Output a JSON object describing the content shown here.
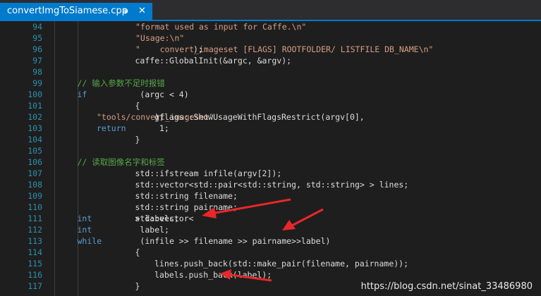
{
  "tab": {
    "title": "convertImgToSiamese.cpp",
    "pin_icon": "pin-icon",
    "close_icon": "close-icon",
    "pin_glyph": "⊕",
    "close_glyph": "✕"
  },
  "lines": [
    {
      "num": "94",
      "indent": 4,
      "segs": [
        [
          "str",
          "\"format used as input for Caffe.\\n\""
        ]
      ]
    },
    {
      "num": "95",
      "indent": 4,
      "segs": [
        [
          "str",
          "\"Usage:\\n\""
        ]
      ]
    },
    {
      "num": "96",
      "indent": 4,
      "segs": [
        [
          "str",
          "\"    convert_imageset [FLAGS] ROOTFOLDER/ LISTFILE DB_NAME\\n\""
        ],
        [
          "txt",
          ");"
        ]
      ]
    },
    {
      "num": "97",
      "indent": 1,
      "segs": [
        [
          "txt",
          "caffe::GlobalInit(&argc, &argv);"
        ]
      ]
    },
    {
      "num": "98",
      "indent": 0,
      "segs": []
    },
    {
      "num": "99",
      "indent": 1,
      "segs": [
        [
          "com",
          "// 输入参数不足时报错"
        ]
      ]
    },
    {
      "num": "100",
      "indent": 1,
      "segs": [
        [
          "kw",
          "if"
        ],
        [
          "txt",
          " (argc < 4)"
        ]
      ]
    },
    {
      "num": "101",
      "indent": 1,
      "segs": [
        [
          "txt",
          "{"
        ]
      ]
    },
    {
      "num": "102",
      "indent": 2,
      "segs": [
        [
          "txt",
          "gflags::ShowUsageWithFlagsRestrict(argv[0], "
        ],
        [
          "str",
          "\"tools/convert_imageset\""
        ],
        [
          "txt",
          ");"
        ]
      ]
    },
    {
      "num": "103",
      "indent": 2,
      "segs": [
        [
          "kw",
          "return"
        ],
        [
          "txt",
          " 1;"
        ]
      ]
    },
    {
      "num": "104",
      "indent": 1,
      "segs": [
        [
          "txt",
          "}"
        ]
      ]
    },
    {
      "num": "105",
      "indent": 0,
      "segs": []
    },
    {
      "num": "106",
      "indent": 1,
      "segs": [
        [
          "com",
          "// 读取图像名字和标签"
        ]
      ]
    },
    {
      "num": "107",
      "indent": 1,
      "segs": [
        [
          "txt",
          "std::ifstream infile(argv[2]);"
        ]
      ]
    },
    {
      "num": "108",
      "indent": 1,
      "segs": [
        [
          "txt",
          "std::vector<std::pair<std::string, std::string> > lines;"
        ]
      ]
    },
    {
      "num": "109",
      "indent": 1,
      "segs": [
        [
          "txt",
          "std::string filename;"
        ]
      ]
    },
    {
      "num": "110",
      "indent": 1,
      "segs": [
        [
          "txt",
          "std::string pairname;"
        ]
      ]
    },
    {
      "num": "111",
      "indent": 1,
      "segs": [
        [
          "txt",
          "std::vector<"
        ],
        [
          "kw",
          "int"
        ],
        [
          "txt",
          "> labels;"
        ]
      ]
    },
    {
      "num": "112",
      "indent": 1,
      "segs": [
        [
          "kw",
          "int"
        ],
        [
          "txt",
          " label;"
        ]
      ]
    },
    {
      "num": "113",
      "indent": 1,
      "segs": [
        [
          "kw",
          "while"
        ],
        [
          "txt",
          " (infile >> filename >> pairname>>label)"
        ]
      ]
    },
    {
      "num": "114",
      "indent": 1,
      "segs": [
        [
          "txt",
          "{"
        ]
      ]
    },
    {
      "num": "115",
      "indent": 2,
      "segs": [
        [
          "txt",
          "lines.push_back(std::make_pair(filename, pairname));"
        ]
      ]
    },
    {
      "num": "116",
      "indent": 2,
      "segs": [
        [
          "txt",
          "labels.push_back(label);"
        ]
      ]
    },
    {
      "num": "117",
      "indent": 1,
      "segs": [
        [
          "txt",
          "}"
        ]
      ]
    }
  ],
  "colors": {
    "accent": "#007acc",
    "keyword": "#569cd6",
    "string": "#d69d85",
    "comment": "#57a64a",
    "line_number": "#2b91af",
    "annotation_arrow": "#e8272a"
  },
  "watermark": "https://blog.csdn.net/sinat_33486980"
}
